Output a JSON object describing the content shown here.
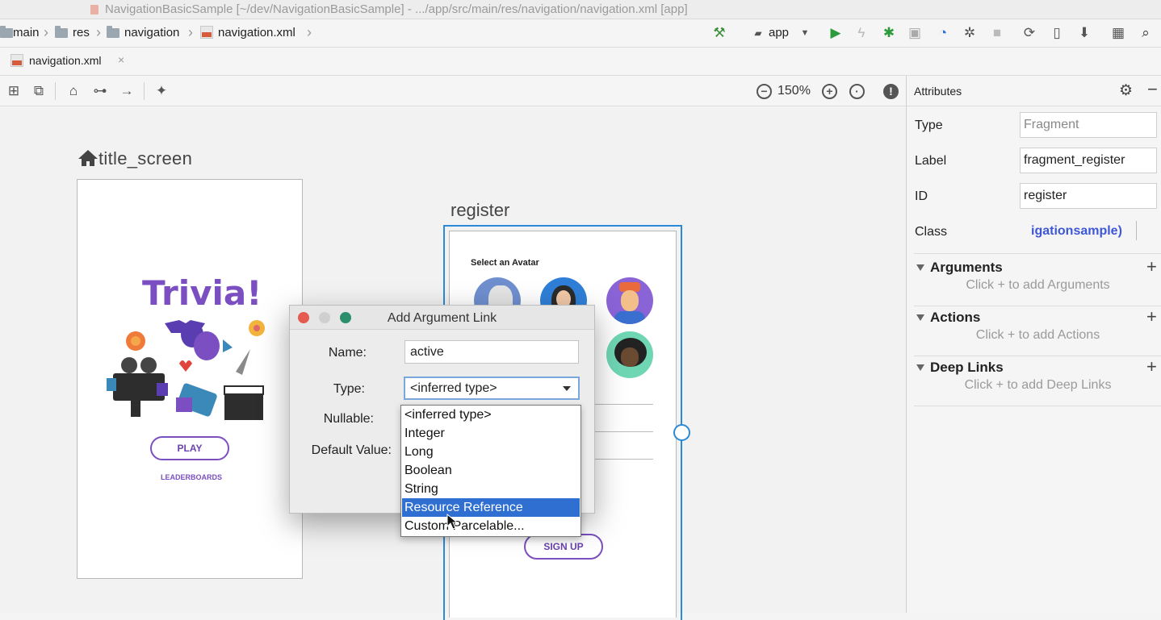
{
  "window": {
    "title": "NavigationBasicSample [~/dev/NavigationBasicSample] - .../app/src/main/res/navigation/navigation.xml [app]"
  },
  "breadcrumb": [
    "main",
    "res",
    "navigation",
    "navigation.xml"
  ],
  "toolbar": {
    "run_config": "app"
  },
  "tab": {
    "label": "navigation.xml",
    "close": "×"
  },
  "design_toolbar": {
    "zoom": "150%"
  },
  "canvas": {
    "title_screen": {
      "label": "title_screen",
      "heading": "Trivia!",
      "play": "PLAY",
      "leaderboards": "LEADERBOARDS"
    },
    "register": {
      "label": "register",
      "select_avatar": "Select an Avatar",
      "signup": "SIGN UP"
    }
  },
  "dialog": {
    "title": "Add Argument Link",
    "name_label": "Name:",
    "name_value": "active",
    "type_label": "Type:",
    "type_value": "<inferred type>",
    "nullable_label": "Nullable:",
    "default_label": "Default Value:",
    "type_options": [
      "<inferred type>",
      "Integer",
      "Long",
      "Boolean",
      "String",
      "Resource Reference",
      "Custom Parcelable..."
    ],
    "selected_option": "Resource Reference"
  },
  "attributes": {
    "title": "Attributes",
    "type_label": "Type",
    "type_value": "Fragment",
    "label_label": "Label",
    "label_value": "fragment_register",
    "id_label": "ID",
    "id_value": "register",
    "class_label": "Class",
    "class_value": "igationsample)",
    "sections": [
      {
        "title": "Arguments",
        "hint": "Click + to add Arguments"
      },
      {
        "title": "Actions",
        "hint": "Click + to add Actions"
      },
      {
        "title": "Deep Links",
        "hint": "Click + to add Deep Links"
      }
    ]
  },
  "colors": {
    "accent_purple": "#7b4fc1",
    "selection_blue": "#2b8ad8",
    "dropdown_highlight": "#2f6fd1",
    "class_link": "#3d57d6"
  }
}
